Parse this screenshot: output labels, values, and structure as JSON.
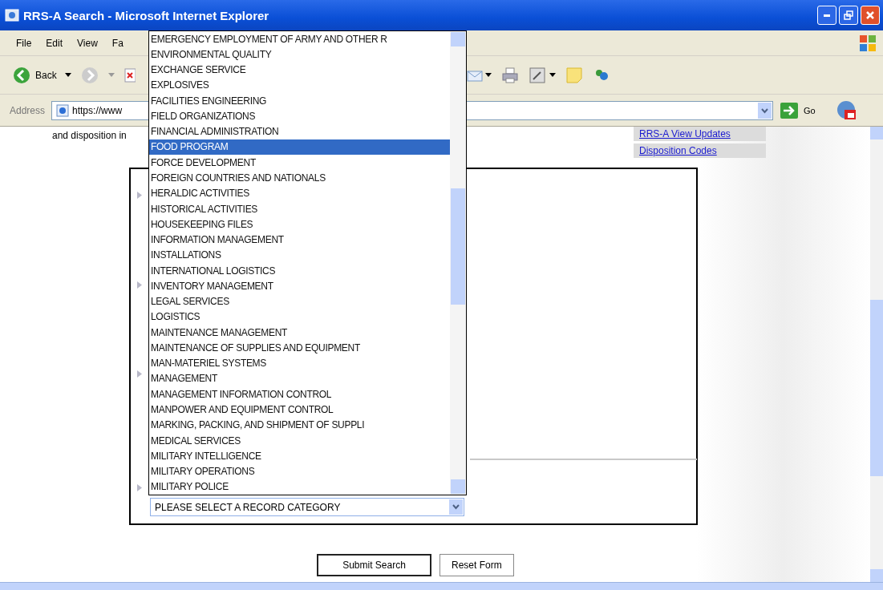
{
  "window": {
    "title": "RRS-A Search - Microsoft Internet Explorer"
  },
  "menu_bar": [
    "File",
    "Edit",
    "View",
    "Fa"
  ],
  "toolbar": {
    "back_label": "Back"
  },
  "address_bar": {
    "label": "Address",
    "value": "https://www",
    "go_label": "Go"
  },
  "page": {
    "intro_text": "and disposition in",
    "links": [
      "RRS-A View Updates",
      "Disposition Codes"
    ],
    "category_select": {
      "value": "PLEASE SELECT A RECORD CATEGORY",
      "expanded": true,
      "options": [
        {
          "label": "EMERGENCY EMPLOYMENT OF ARMY AND OTHER R",
          "selected": false
        },
        {
          "label": "ENVIRONMENTAL QUALITY",
          "selected": false
        },
        {
          "label": "EXCHANGE SERVICE",
          "selected": false
        },
        {
          "label": "EXPLOSIVES",
          "selected": false
        },
        {
          "label": "FACILITIES ENGINEERING",
          "selected": false
        },
        {
          "label": "FIELD ORGANIZATIONS",
          "selected": false
        },
        {
          "label": "FINANCIAL ADMINISTRATION",
          "selected": false
        },
        {
          "label": "FOOD PROGRAM",
          "selected": true
        },
        {
          "label": "FORCE DEVELOPMENT",
          "selected": false
        },
        {
          "label": "FOREIGN COUNTRIES AND NATIONALS",
          "selected": false
        },
        {
          "label": "HERALDIC ACTIVITIES",
          "selected": false
        },
        {
          "label": "HISTORICAL ACTIVITIES",
          "selected": false
        },
        {
          "label": "HOUSEKEEPING FILES",
          "selected": false
        },
        {
          "label": "INFORMATION MANAGEMENT",
          "selected": false
        },
        {
          "label": "INSTALLATIONS",
          "selected": false
        },
        {
          "label": "INTERNATIONAL LOGISTICS",
          "selected": false
        },
        {
          "label": "INVENTORY MANAGEMENT",
          "selected": false
        },
        {
          "label": "LEGAL SERVICES",
          "selected": false
        },
        {
          "label": "LOGISTICS",
          "selected": false
        },
        {
          "label": "MAINTENANCE MANAGEMENT",
          "selected": false
        },
        {
          "label": "MAINTENANCE OF SUPPLIES AND EQUIPMENT",
          "selected": false
        },
        {
          "label": "MAN-MATERIEL SYSTEMS",
          "selected": false
        },
        {
          "label": "MANAGEMENT",
          "selected": false
        },
        {
          "label": "MANAGEMENT INFORMATION CONTROL",
          "selected": false
        },
        {
          "label": "MANPOWER AND EQUIPMENT CONTROL",
          "selected": false
        },
        {
          "label": "MARKING, PACKING, AND SHIPMENT OF SUPPLI",
          "selected": false
        },
        {
          "label": "MEDICAL SERVICES",
          "selected": false
        },
        {
          "label": "MILITARY INTELLIGENCE",
          "selected": false
        },
        {
          "label": "MILITARY OPERATIONS",
          "selected": false
        },
        {
          "label": "MILITARY POLICE",
          "selected": false
        }
      ]
    },
    "buttons": [
      "Submit Search",
      "Reset Form"
    ]
  }
}
